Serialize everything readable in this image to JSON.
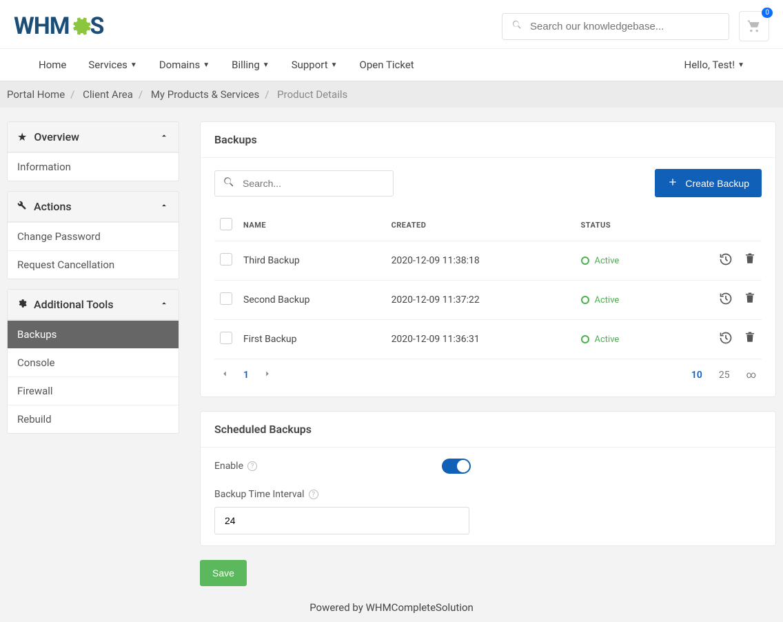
{
  "header": {
    "logo_text": "WHMCS",
    "search_placeholder": "Search our knowledgebase...",
    "cart_badge": "0"
  },
  "nav": {
    "items": [
      "Home",
      "Services",
      "Domains",
      "Billing",
      "Support",
      "Open Ticket"
    ],
    "greeting": "Hello, Test!"
  },
  "breadcrumb": {
    "portal": "Portal Home",
    "client": "Client Area",
    "products": "My Products & Services",
    "current": "Product Details"
  },
  "sidebar": {
    "overview": {
      "title": "Overview",
      "items": [
        "Information"
      ]
    },
    "actions": {
      "title": "Actions",
      "items": [
        "Change Password",
        "Request Cancellation"
      ]
    },
    "tools": {
      "title": "Additional Tools",
      "items": [
        "Backups",
        "Console",
        "Firewall",
        "Rebuild"
      ],
      "active": 0
    }
  },
  "backups": {
    "title": "Backups",
    "search_placeholder": "Search...",
    "create_label": "Create Backup",
    "columns": {
      "name": "NAME",
      "created": "CREATED",
      "status": "STATUS"
    },
    "rows": [
      {
        "name": "Third Backup",
        "created": "2020-12-09 11:38:18",
        "status": "Active"
      },
      {
        "name": "Second Backup",
        "created": "2020-12-09 11:37:22",
        "status": "Active"
      },
      {
        "name": "First Backup",
        "created": "2020-12-09 11:36:31",
        "status": "Active"
      }
    ],
    "pager": {
      "page": "1",
      "sizes": [
        "10",
        "25",
        "∞"
      ],
      "active_size": 0
    }
  },
  "scheduled": {
    "title": "Scheduled Backups",
    "enable_label": "Enable",
    "interval_label": "Backup Time Interval",
    "interval_value": "24"
  },
  "save_label": "Save",
  "footer": {
    "powered": "Powered by ",
    "product": "WHMCompleteSolution"
  }
}
